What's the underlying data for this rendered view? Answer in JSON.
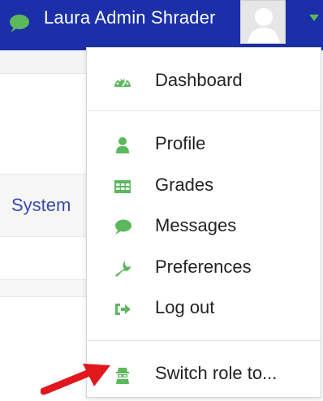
{
  "navbar": {
    "username": "Laura Admin Shrader",
    "chat_icon": "chat-icon",
    "caret_icon": "chevron-down-icon",
    "avatar_icon": "user-avatar-icon"
  },
  "background": {
    "system_link": "System"
  },
  "menu": {
    "items": [
      {
        "label": "Dashboard",
        "icon": "dashboard-icon"
      },
      {
        "label": "Profile",
        "icon": "user-icon"
      },
      {
        "label": "Grades",
        "icon": "table-icon"
      },
      {
        "label": "Messages",
        "icon": "chat-icon"
      },
      {
        "label": "Preferences",
        "icon": "wrench-icon"
      },
      {
        "label": "Log out",
        "icon": "sign-out-icon"
      },
      {
        "label": "Switch role to...",
        "icon": "user-secret-icon"
      }
    ]
  },
  "colors": {
    "navbar_bg": "#1a2fa8",
    "icon_green": "#5cb85c",
    "arrow_red": "#e0181e",
    "link_blue": "#3a4aa8"
  }
}
